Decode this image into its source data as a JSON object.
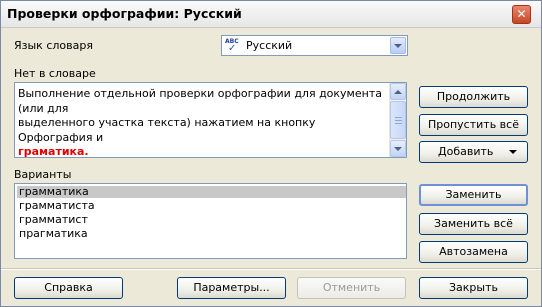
{
  "window": {
    "title": "Проверки орфографии: Русский",
    "close_glyph": "✕"
  },
  "dictionary": {
    "label": "Язык словаря",
    "value": "Русский",
    "icon": "abc-spellcheck-icon"
  },
  "not_in_dictionary": {
    "label": "Нет в словаре",
    "line1": "Выполнение отдельной проверки орфографии для документа (или для",
    "line2": "выделенного участка текста) нажатием на кнопку Орфография и",
    "misspelled_word": "граматика.",
    "misspelled_color": "#e00000"
  },
  "suggestions": {
    "label": "Варианты",
    "items": [
      "грамматика",
      "грамматиста",
      "грамматист",
      "прагматика"
    ],
    "selected_index": 0
  },
  "buttons": {
    "continue": "Продолжить",
    "skip_all": "Пропустить всё",
    "add": "Добавить",
    "replace": "Заменить",
    "replace_all": "Заменить всё",
    "autocorrect": "Автозамена",
    "help": "Справка",
    "options": "Параметры...",
    "cancel": "Отменить",
    "close": "Закрыть"
  },
  "colors": {
    "dialog_background": "#ece9d8",
    "default_button_border": "#6f8fd6",
    "selection": "#c8c8c8"
  }
}
